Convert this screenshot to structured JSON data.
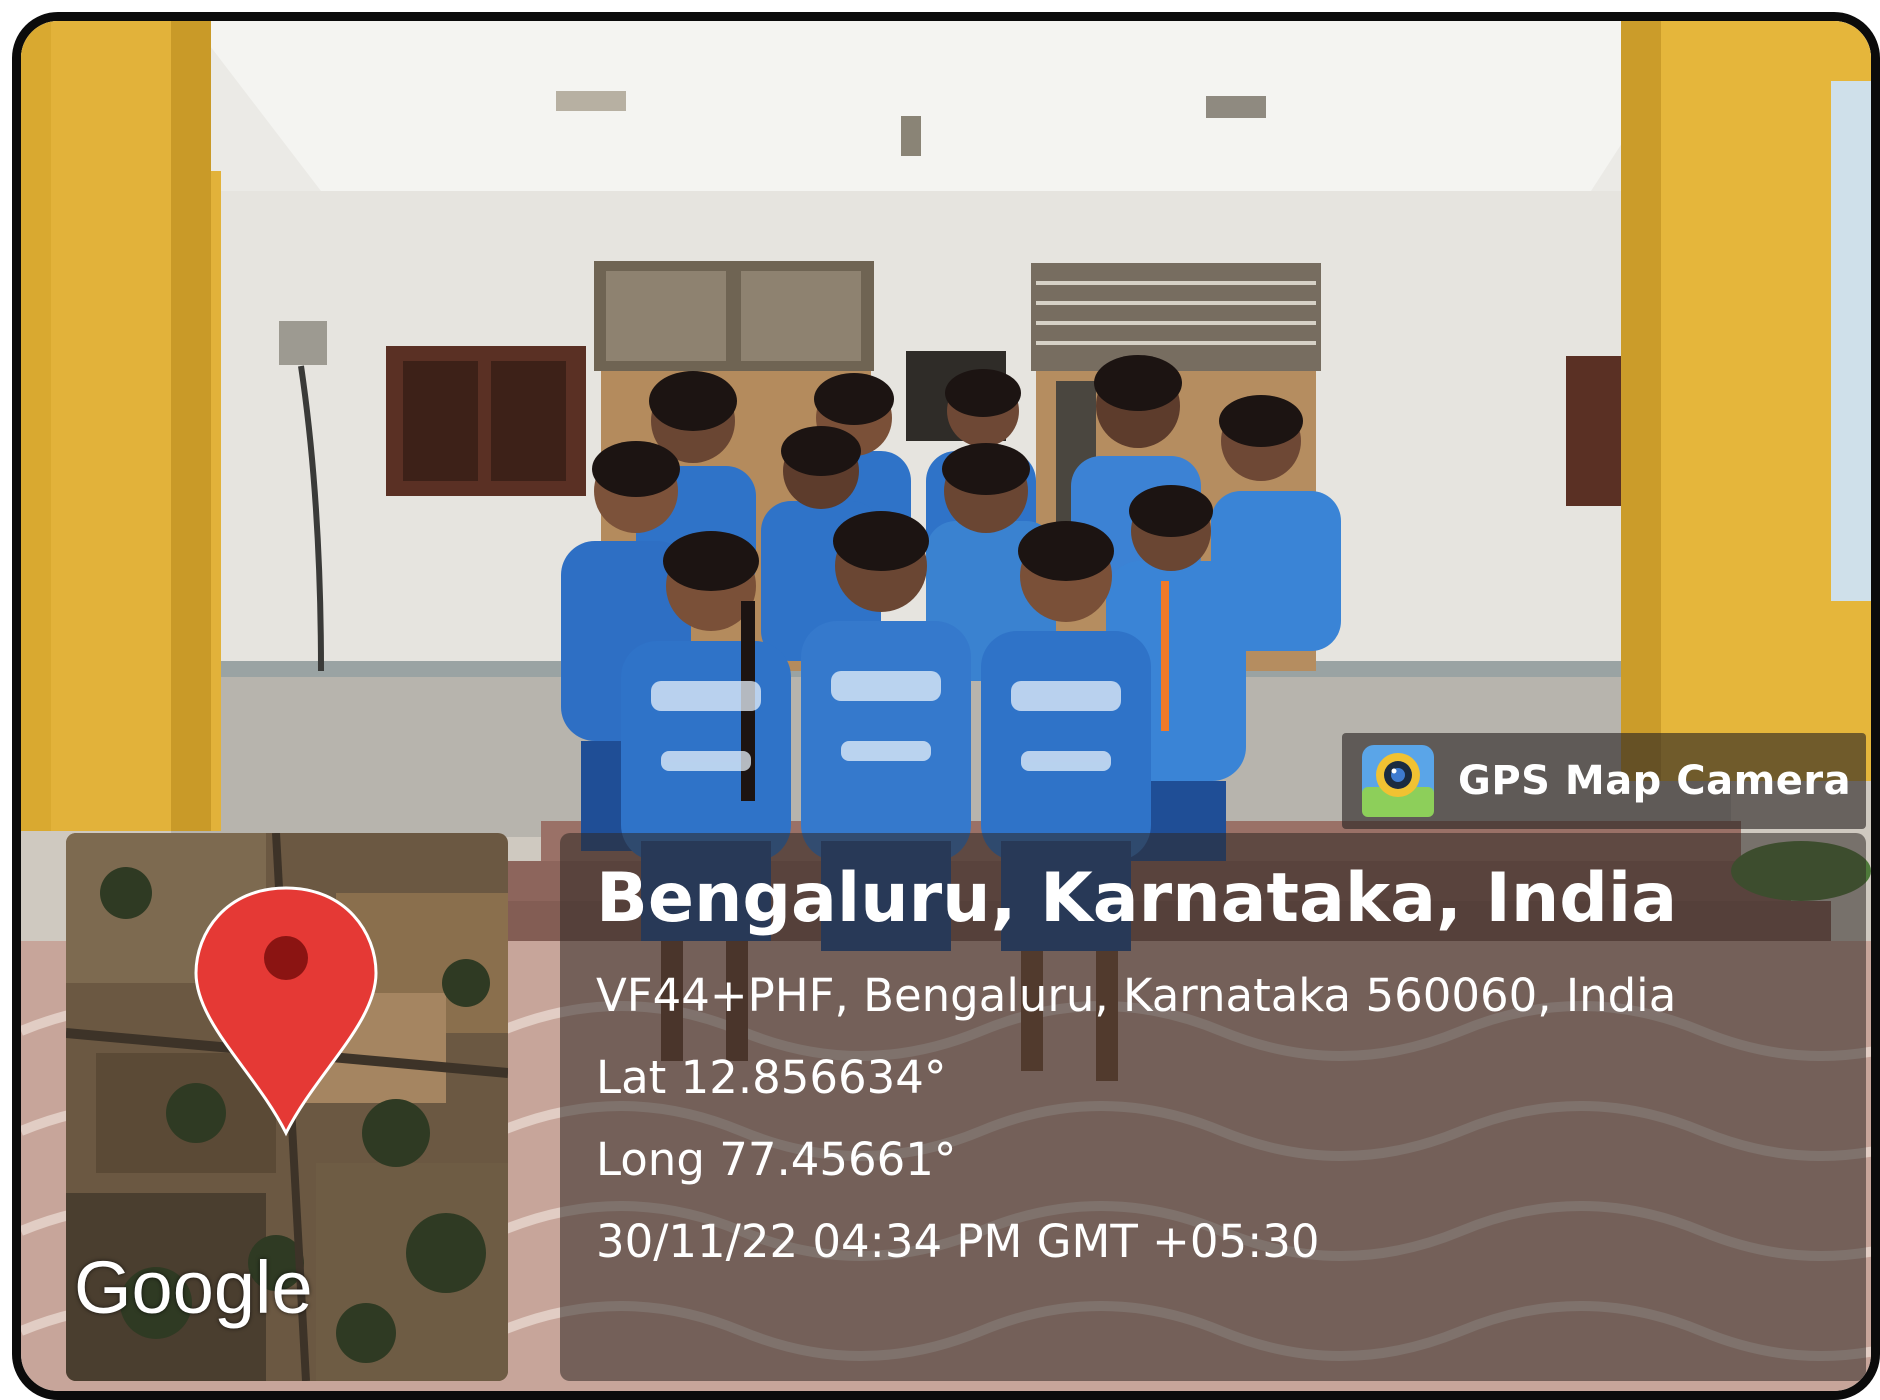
{
  "badge": {
    "label": "GPS Map Camera",
    "icon": "gps-map-camera-app-icon"
  },
  "map": {
    "brand": "Google",
    "marker_icon": "red-location-pin-icon",
    "marker_color": "#e53935"
  },
  "location": {
    "title": "Bengaluru, Karnataka, India",
    "address": "VF44+PHF, Bengaluru, Karnataka 560060, India",
    "latitude": "Lat 12.856634°",
    "longitude": "Long 77.45661°",
    "timestamp": "30/11/22 04:34 PM GMT +05:30"
  },
  "colors": {
    "pillar": "#e9b73a",
    "jersey": "#2f73c8",
    "panel": "#302824"
  }
}
